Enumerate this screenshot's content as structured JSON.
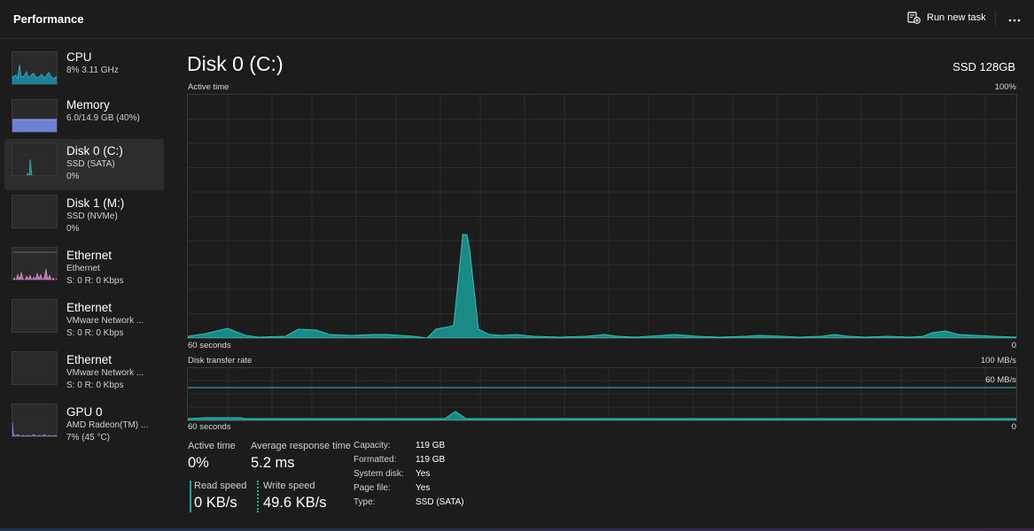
{
  "header": {
    "title": "Performance",
    "run_new_task": "Run new task"
  },
  "sidebar": {
    "items": [
      {
        "name": "CPU",
        "sub1": "8%  3.11 GHz",
        "sub2": "",
        "color": "#1fa7c9"
      },
      {
        "name": "Memory",
        "sub1": "6.0/14.9 GB (40%)",
        "sub2": "",
        "color": "#7b8ae0"
      },
      {
        "name": "Disk 0 (C:)",
        "sub1": "SSD (SATA)",
        "sub2": "0%",
        "color": "#1fa7a2"
      },
      {
        "name": "Disk 1 (M:)",
        "sub1": "SSD (NVMe)",
        "sub2": "0%",
        "color": "#1fa7a2"
      },
      {
        "name": "Ethernet",
        "sub1": "Ethernet",
        "sub2": "S: 0  R: 0 Kbps",
        "color": "#d089c8"
      },
      {
        "name": "Ethernet",
        "sub1": "VMware Network ...",
        "sub2": "S: 0  R: 0 Kbps",
        "color": "#d089c8"
      },
      {
        "name": "Ethernet",
        "sub1": "VMware Network ...",
        "sub2": "S: 0  R: 0 Kbps",
        "color": "#d089c8"
      },
      {
        "name": "GPU 0",
        "sub1": "AMD Radeon(TM) ...",
        "sub2": "7%  (45 °C)",
        "color": "#9a7fd0"
      }
    ]
  },
  "main": {
    "title": "Disk 0 (C:)",
    "model": "SSD 128GB",
    "active_time_graph": {
      "label": "Active time",
      "max_label": "100%",
      "left_axis": "60 seconds",
      "right_axis": "0"
    },
    "transfer_graph": {
      "label": "Disk transfer rate",
      "max_label": "100 MB/s",
      "inner_label": "60 MB/s",
      "left_axis": "60 seconds",
      "right_axis": "0"
    },
    "stats": {
      "active_time_label": "Active time",
      "active_time_value": "0%",
      "avg_response_label": "Average response time",
      "avg_response_value": "5.2 ms",
      "read_speed_label": "Read speed",
      "read_speed_value": "0 KB/s",
      "write_speed_label": "Write speed",
      "write_speed_value": "49.6 KB/s"
    },
    "properties": [
      {
        "key": "Capacity:",
        "value": "119 GB"
      },
      {
        "key": "Formatted:",
        "value": "119 GB"
      },
      {
        "key": "System disk:",
        "value": "Yes"
      },
      {
        "key": "Page file:",
        "value": "Yes"
      },
      {
        "key": "Type:",
        "value": "SSD (SATA)"
      }
    ]
  },
  "colors": {
    "accent": "#1fa7a2",
    "background": "#1c1c1c",
    "selected_item": "#2d2d2d"
  }
}
